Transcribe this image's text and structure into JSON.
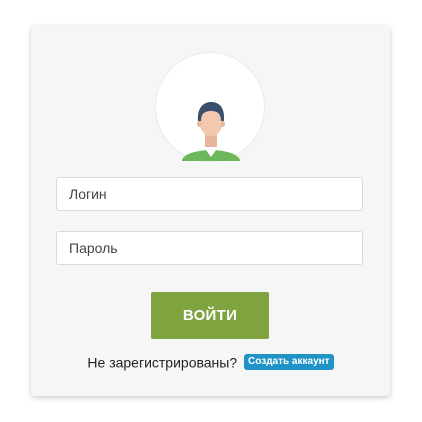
{
  "login_form": {
    "avatar_icon": "user-avatar-icon",
    "username": {
      "placeholder": "Логин",
      "value": ""
    },
    "password": {
      "placeholder": "Пароль",
      "value": ""
    },
    "submit_label": "ВОЙТИ",
    "register_prompt": "Не зарегистрированы?",
    "create_account_label": "Создать аккаунт"
  },
  "colors": {
    "card_background": "#f6f6f6",
    "button_green": "#7fa33e",
    "badge_blue": "#1f93c6",
    "avatar_shirt_green": "#6cb85a",
    "avatar_hair": "#3a4f6b",
    "avatar_skin": "#f2c9b0"
  }
}
